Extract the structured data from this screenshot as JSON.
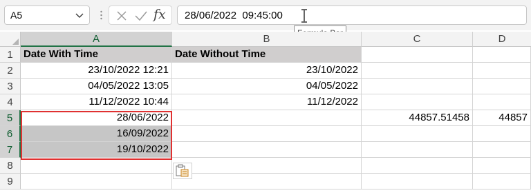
{
  "name_box": {
    "value": "A5",
    "dropdown_icon": "chevron-down-icon"
  },
  "formula_bar": {
    "content": "28/06/2022  09:45:00",
    "cancel_icon": "cancel-x-icon",
    "enter_icon": "checkmark-icon",
    "insert_function_label": "fx",
    "cursor_icon": "text-cursor-ibeam-icon",
    "tooltip": "Formula Bar"
  },
  "columns": [
    "A",
    "B",
    "C",
    "D"
  ],
  "rows": [
    "1",
    "2",
    "3",
    "4",
    "5",
    "6",
    "7",
    "8",
    "9"
  ],
  "cells": {
    "header_a": "Date With Time",
    "header_b": "Date Without Time",
    "r2": {
      "a": "23/10/2022 12:21",
      "b": "23/10/2022"
    },
    "r3": {
      "a": "04/05/2022 13:05",
      "b": "04/05/2022"
    },
    "r4": {
      "a": "11/12/2022 10:44",
      "b": "11/12/2022"
    },
    "r5": {
      "a": "28/06/2022",
      "c": "44857.51458",
      "d": "44857"
    },
    "r6": {
      "a": "16/09/2022"
    },
    "r7": {
      "a": "19/10/2022"
    }
  },
  "paste_options_icon": "paste-options-icon",
  "colors": {
    "header_fill": "#d0cece",
    "selection_fill": "#c6c6c6",
    "highlight_border": "#e03131",
    "excel_green": "#217346"
  }
}
